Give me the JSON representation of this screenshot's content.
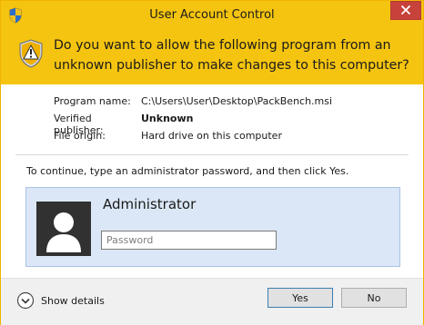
{
  "window": {
    "title": "User Account Control",
    "header_question": "Do you want to allow the following program from an unknown publisher to make changes to this computer?"
  },
  "details": {
    "program_name_label": "Program name:",
    "program_name_value": "C:\\Users\\User\\Desktop\\PackBench.msi",
    "publisher_label": "Verified publisher:",
    "publisher_value": "Unknown",
    "origin_label": "File origin:",
    "origin_value": "Hard drive on this computer"
  },
  "instruction": "To continue, type an administrator password, and then click Yes.",
  "credential": {
    "username": "Administrator",
    "password_placeholder": "Password"
  },
  "footer": {
    "show_details_label": "Show details",
    "yes_label": "Yes",
    "no_label": "No"
  },
  "colors": {
    "banner": "#f5c410",
    "close_button": "#c7423a",
    "credential_panel": "#dbe7f6"
  },
  "icons": {
    "app": "uac-shield-icon",
    "header": "warning-shield-icon",
    "avatar": "user-avatar-icon",
    "details": "chevron-down-circle-icon",
    "close": "close-icon"
  }
}
